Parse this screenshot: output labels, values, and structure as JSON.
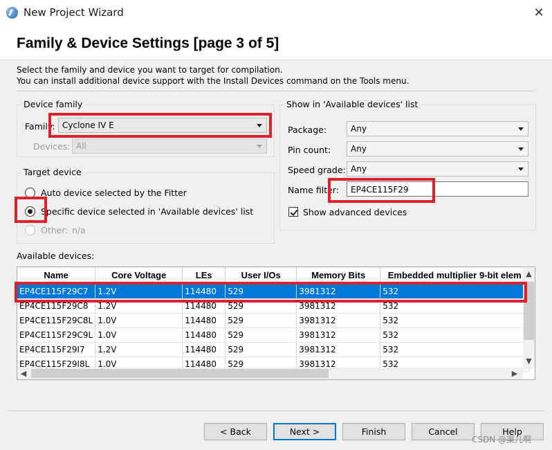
{
  "window": {
    "title": "New Project Wizard",
    "close_glyph": "✕",
    "icon": "app-globe-icon"
  },
  "page": {
    "title": "Family & Device Settings [page 3 of 5]",
    "desc_line1": "Select the family and device you want to target for compilation.",
    "desc_line2": "You can install additional device support with the Install Devices command on the Tools menu."
  },
  "device_family": {
    "legend": "Device family",
    "family_label": "Family:",
    "family_value": "Cyclone IV E",
    "devices_label": "Devices:",
    "devices_value": "All"
  },
  "target_device": {
    "legend": "Target device",
    "auto_label": "Auto device selected by the Fitter",
    "specific_label": "Specific device selected in 'Available devices' list",
    "specific_selected": true,
    "other_label": "Other:",
    "other_value": "n/a"
  },
  "show_list": {
    "legend": "Show in 'Available devices' list",
    "package_label": "Package:",
    "package_value": "Any",
    "pin_count_label": "Pin count:",
    "pin_count_value": "Any",
    "speed_grade_label": "Speed grade:",
    "speed_grade_value": "Any",
    "name_filter_label": "Name filter:",
    "name_filter_value": "EP4CE115F29",
    "show_advanced_label": "Show advanced devices",
    "show_advanced_checked": true
  },
  "devices": {
    "label": "Available devices:",
    "columns": [
      "Name",
      "Core Voltage",
      "LEs",
      "User I/Os",
      "Memory Bits",
      "Embedded multiplier 9-bit elem"
    ],
    "rows": [
      [
        "EP4CE115F29C7",
        "1.2V",
        "114480",
        "529",
        "3981312",
        "532"
      ],
      [
        "EP4CE115F29C8",
        "1.2V",
        "114480",
        "529",
        "3981312",
        "532"
      ],
      [
        "EP4CE115F29C8L",
        "1.0V",
        "114480",
        "529",
        "3981312",
        "532"
      ],
      [
        "EP4CE115F29C9L",
        "1.0V",
        "114480",
        "529",
        "3981312",
        "532"
      ],
      [
        "EP4CE115F29I7",
        "1.2V",
        "114480",
        "529",
        "3981312",
        "532"
      ],
      [
        "EP4CE115F29I8L",
        "1.0V",
        "114480",
        "529",
        "3981312",
        "532"
      ]
    ],
    "selected_row": 0
  },
  "buttons": {
    "back": "< Back",
    "next": "Next >",
    "finish": "Finish",
    "cancel": "Cancel",
    "help": "Help"
  },
  "watermark": "CSDN @渠儿啊",
  "colors": {
    "selection": "#0078d7",
    "highlight_box": "#e0202a"
  }
}
